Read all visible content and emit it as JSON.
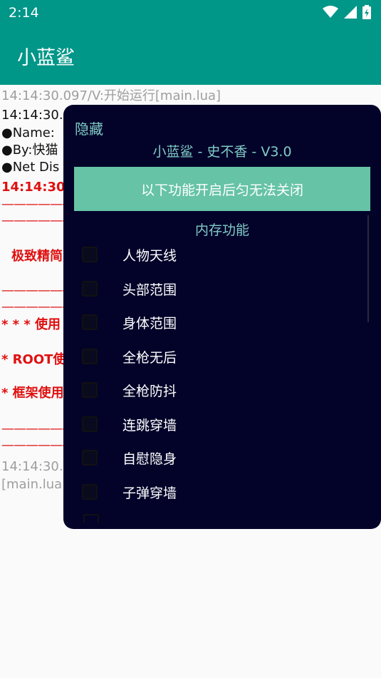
{
  "status_bar": {
    "time": "2:14",
    "icons": [
      "wifi-icon",
      "signal-icon",
      "battery-icon"
    ]
  },
  "app_bar": {
    "title": "小蓝鲨"
  },
  "log": {
    "line1": "14:14:30.097/V:开始运行[main.lua]",
    "line2": "14:14:30.",
    "line3": "●Name:",
    "line4": "●By:快猫",
    "line5": "●Net Dis",
    "line6": "14:14:30.",
    "dashes": "————————",
    "line_feature": "极致精简",
    "line_use": "* * * 使用",
    "line_root": "* ROOT使",
    "line_frame": "* 框架使用",
    "line_time2": "14:14:30.",
    "line_main": "[main.lua]"
  },
  "dialog": {
    "hide_label": "隐藏",
    "subtitle": "小蓝鲨 - 史不香 - V3.0",
    "notice": "以下功能开启后匀无法关闭",
    "section_title": "内存功能",
    "options": [
      {
        "label": "人物天线",
        "checked": false
      },
      {
        "label": "头部范围",
        "checked": false
      },
      {
        "label": "身体范围",
        "checked": false
      },
      {
        "label": "全枪无后",
        "checked": false
      },
      {
        "label": "全枪防抖",
        "checked": false
      },
      {
        "label": "连跳穿墙",
        "checked": false
      },
      {
        "label": "自慰隐身",
        "checked": false
      },
      {
        "label": "子弹穿墙",
        "checked": false
      }
    ]
  },
  "colors": {
    "primary": "#009688",
    "dialog_bg": "#03032a",
    "accent": "#80cbc4",
    "notice_bg": "#66c3a5",
    "log_red": "#e01010"
  }
}
